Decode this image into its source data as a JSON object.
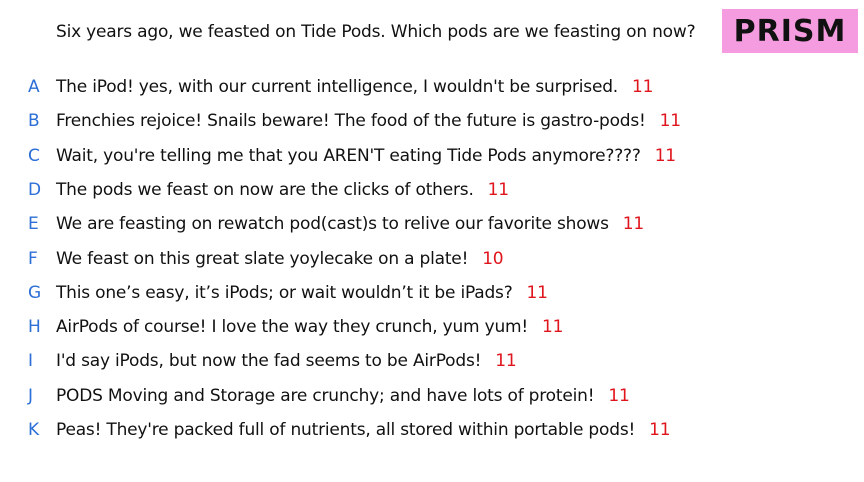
{
  "question": "Six years ago, we feasted on Tide Pods. Which pods are we feasting on now?",
  "brand": {
    "logo_text": "PRISM",
    "logo_bg_color": "#f59ce0"
  },
  "colors": {
    "letter": "#2c6fd6",
    "score": "#e0141c",
    "text": "#111111"
  },
  "answers": [
    {
      "letter": "A",
      "text": "The iPod! yes, with our current intelligence, I wouldn't be surprised.",
      "score": "11"
    },
    {
      "letter": "B",
      "text": "Frenchies rejoice! Snails beware! The food of the future is gastro-pods!",
      "score": "11"
    },
    {
      "letter": "C",
      "text": "Wait, you're telling me that you AREN'T eating Tide Pods anymore????",
      "score": "11"
    },
    {
      "letter": "D",
      "text": "The pods we feast on now are the clicks of others.",
      "score": "11"
    },
    {
      "letter": "E",
      "text": "We are feasting on rewatch pod(cast)s to relive our favorite shows",
      "score": "11"
    },
    {
      "letter": "F",
      "text": "We feast on this great slate yoylecake on a plate!",
      "score": "10"
    },
    {
      "letter": "G",
      "text": "This one’s easy, it’s iPods; or wait wouldn’t it be iPads?",
      "score": "11"
    },
    {
      "letter": "H",
      "text": "AirPods of course! I love the way they crunch, yum yum!",
      "score": "11"
    },
    {
      "letter": "I",
      "text": "I'd say iPods, but now the fad seems to be AirPods!",
      "score": "11"
    },
    {
      "letter": "J",
      "text": "PODS Moving and Storage are crunchy; and have lots of protein!",
      "score": "11"
    },
    {
      "letter": "K",
      "text": "Peas! They're packed full of nutrients, all stored within portable pods!",
      "score": "11"
    }
  ]
}
